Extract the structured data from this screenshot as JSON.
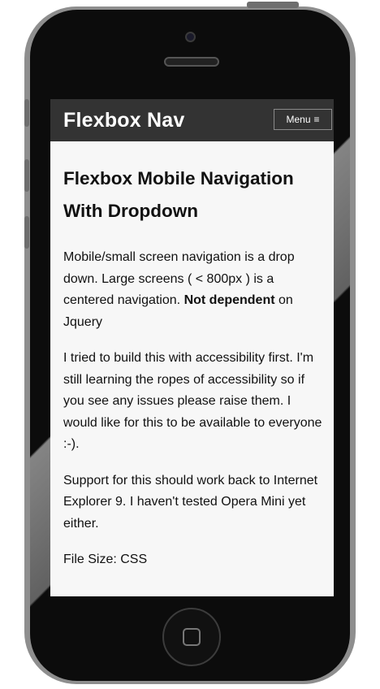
{
  "nav": {
    "title": "Flexbox Nav",
    "menu_label": "Menu",
    "menu_icon": "hamburger-icon"
  },
  "article": {
    "heading": "Flexbox Mobile Navigation With Dropdown",
    "p1_text": "Mobile/small screen navigation is a drop down. Large screens ( < 800px ) is a centered navigation.",
    "p1_bold": "Not dependent",
    "p1_tail": "on Jquery",
    "p2": "I tried to build this with accessibility first. I'm still learning the ropes of accessibility so if you see any issues please raise them. I would like for this to be available to everyone :-).",
    "p3": "Support for this should work back to Internet Explorer 9. I haven't tested Opera Mini yet either.",
    "p4": "File Size: CSS"
  },
  "colors": {
    "nav_bg": "#333333",
    "page_bg": "#f7f7f7",
    "text": "#111111",
    "device": "#0c0c0c"
  }
}
